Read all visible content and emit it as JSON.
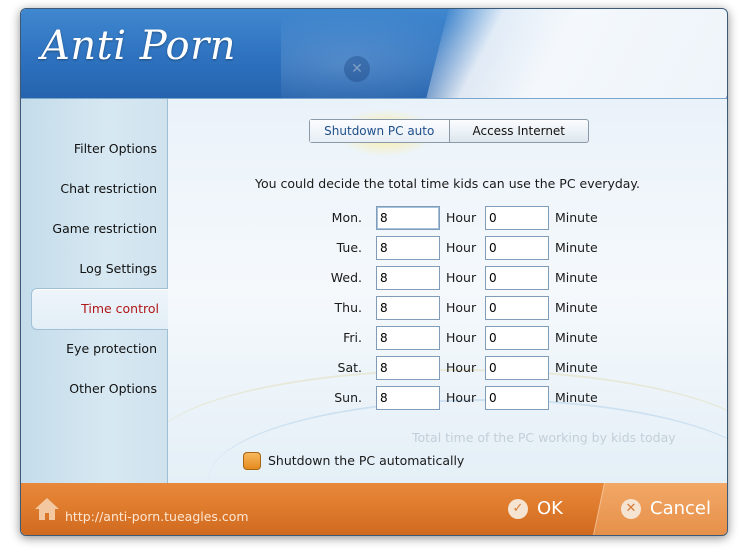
{
  "app": {
    "title": "Anti Porn"
  },
  "sidebar": {
    "items": [
      {
        "label": "Filter Options",
        "active": false
      },
      {
        "label": "Chat restriction",
        "active": false
      },
      {
        "label": "Game restriction",
        "active": false
      },
      {
        "label": "Log Settings",
        "active": false
      },
      {
        "label": "Time control",
        "active": true
      },
      {
        "label": "Eye protection",
        "active": false
      },
      {
        "label": "Other Options",
        "active": false
      }
    ]
  },
  "tabs": [
    {
      "label": "Shutdown PC auto",
      "active": true
    },
    {
      "label": "Access Internet",
      "active": false
    }
  ],
  "main": {
    "description": "You could decide the total time kids can use the PC everyday.",
    "hour_label": "Hour",
    "minute_label": "Minute",
    "days": [
      {
        "day": "Mon.",
        "hour": "8",
        "minute": "0"
      },
      {
        "day": "Tue.",
        "hour": "8",
        "minute": "0"
      },
      {
        "day": "Wed.",
        "hour": "8",
        "minute": "0"
      },
      {
        "day": "Thu.",
        "hour": "8",
        "minute": "0"
      },
      {
        "day": "Fri.",
        "hour": "8",
        "minute": "0"
      },
      {
        "day": "Sat.",
        "hour": "8",
        "minute": "0"
      },
      {
        "day": "Sun.",
        "hour": "8",
        "minute": "0"
      }
    ],
    "today_usage_text": "Total time of the PC working by kids today",
    "shutdown_checkbox_label": "Shutdown the PC automatically"
  },
  "footer": {
    "url": "http://anti-porn.tueagles.com",
    "ok_label": "OK",
    "cancel_label": "Cancel"
  },
  "colors": {
    "header_blue": "#2e72bf",
    "footer_orange": "#de7a2c",
    "active_nav_text": "#b01818",
    "checkbox_orange": "#e48a1e"
  }
}
